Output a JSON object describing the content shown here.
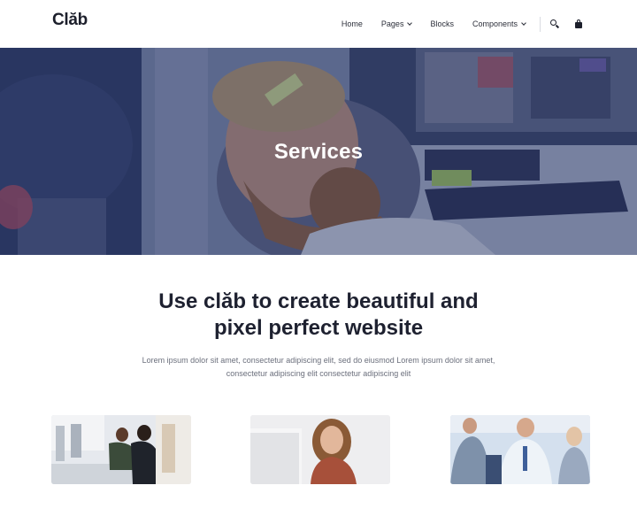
{
  "navbar": {
    "logo": "Clăb",
    "items": [
      {
        "label": "Home"
      },
      {
        "label": "Pages"
      },
      {
        "label": "Blocks"
      },
      {
        "label": "Components"
      }
    ],
    "icons": [
      "search-icon",
      "shopping-bag-icon"
    ]
  },
  "hero": {
    "title": "Services",
    "image": "man-with-beard-laughing-at-desk",
    "overlay_color": "#2d3a6b"
  },
  "intro": {
    "heading_line1": "Use clăb to create beautiful and",
    "heading_line2": "pixel perfect website",
    "text_line1": "Lorem ipsum dolor sit amet, consectetur adipiscing elit, sed do eiusmod Lorem ipsum dolor sit amet,",
    "text_line2": "consectetur adipiscing elit consectetur adipiscing elit"
  },
  "cards": [
    {
      "image": "office-workers-at-computers"
    },
    {
      "image": "smiling-woman-at-laptop"
    },
    {
      "image": "business-team-meeting"
    }
  ]
}
